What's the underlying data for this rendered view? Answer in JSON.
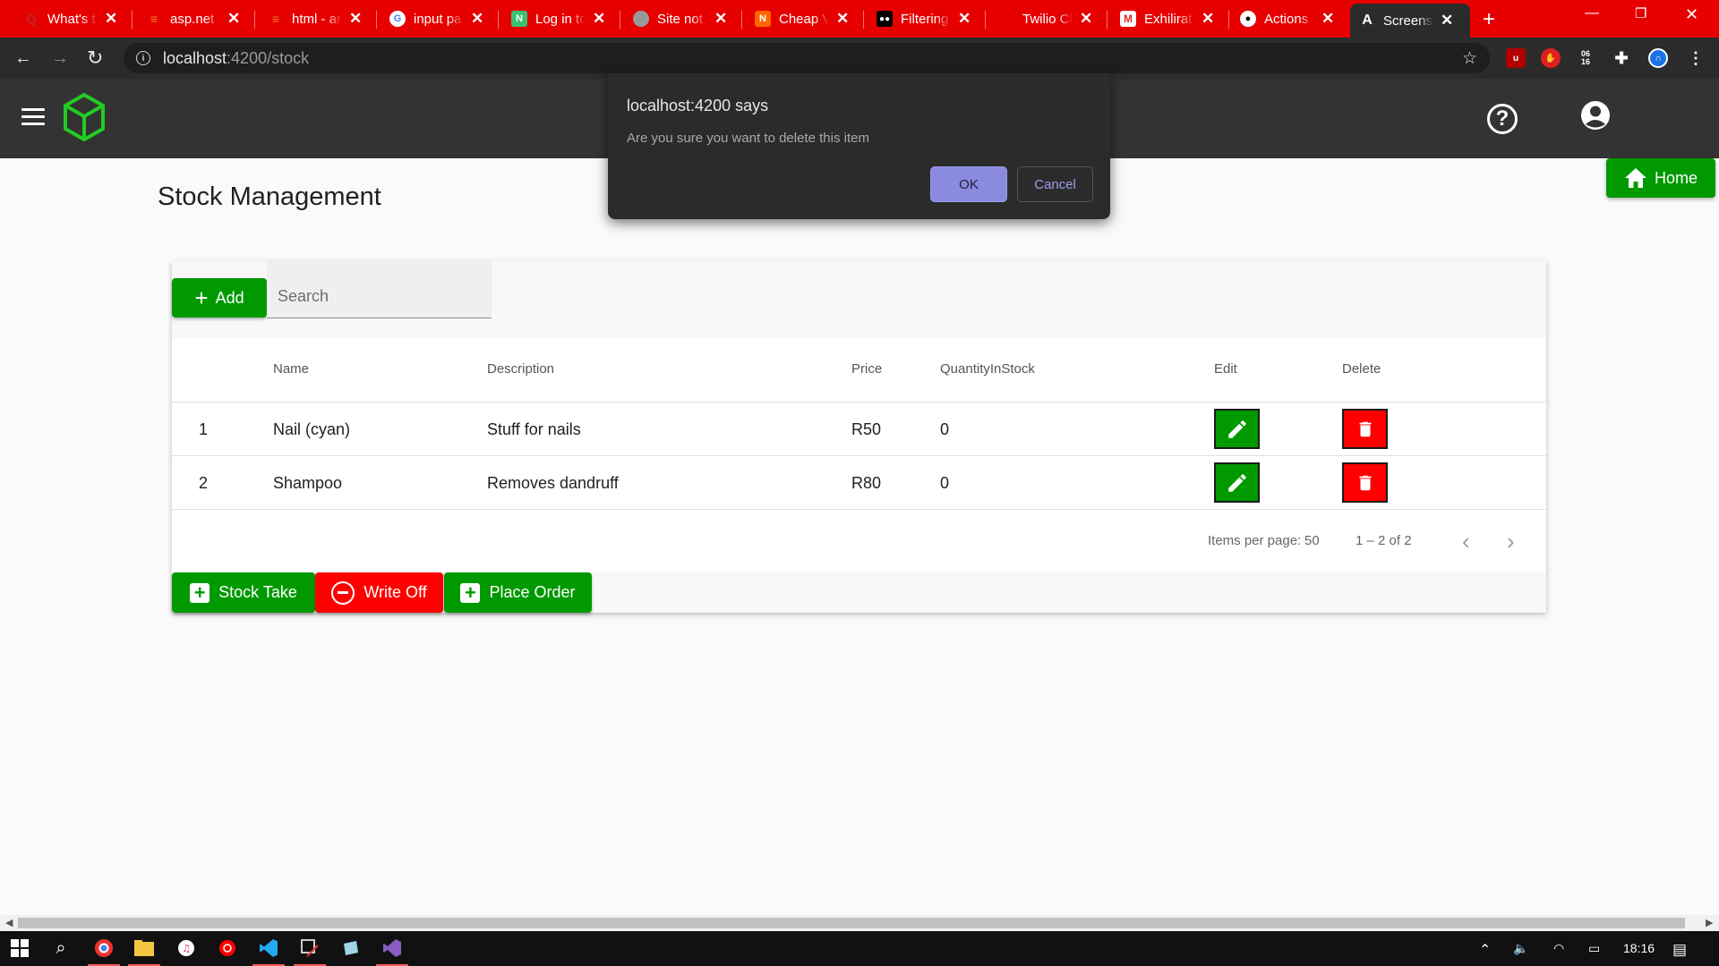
{
  "browser": {
    "tabs": [
      {
        "title": "What's t",
        "icon": "quora-icon",
        "color": "#b92b27"
      },
      {
        "title": "asp.net -",
        "icon": "stackoverflow-icon",
        "color": "#f48024"
      },
      {
        "title": "html - ar",
        "icon": "stackoverflow-icon",
        "color": "#f48024"
      },
      {
        "title": "input pa",
        "icon": "google-icon",
        "color": "#ffffff"
      },
      {
        "title": "Log in tc",
        "icon": "n-icon",
        "color": "#38c172"
      },
      {
        "title": "Site not",
        "icon": "globe-icon",
        "color": "#888888"
      },
      {
        "title": "Cheap V",
        "icon": "cheap-icon",
        "color": "#ff6600"
      },
      {
        "title": "Filtering",
        "icon": "medium-icon",
        "color": "#000000"
      },
      {
        "title": "Twilio Cl",
        "icon": "twilio-icon",
        "color": "#e60000"
      },
      {
        "title": "Exhilirat",
        "icon": "gmail-icon",
        "color": "#ffffff"
      },
      {
        "title": "Actions",
        "icon": "github-icon",
        "color": "#ffffff"
      }
    ],
    "active_tab": {
      "title": "Screens",
      "icon": "angular-icon"
    },
    "url_host": "localhost",
    "url_path": ":4200/stock",
    "clock_ext": "06\n16"
  },
  "app": {
    "home_label": "Home",
    "page_title": "Stock Management",
    "add_label": "Add",
    "search_placeholder": "Search",
    "columns": [
      "Name",
      "Description",
      "Price",
      "QuantityInStock",
      "Edit",
      "Delete"
    ],
    "rows": [
      {
        "index": "1",
        "name": "Nail (cyan)",
        "description": "Stuff for nails",
        "price": "R50",
        "qty": "0"
      },
      {
        "index": "2",
        "name": "Shampoo",
        "description": "Removes dandruff",
        "price": "R80",
        "qty": "0"
      }
    ],
    "paginator": {
      "label": "Items per page:",
      "size": "50",
      "range": "1 – 2 of 2"
    },
    "actions": {
      "stock_take": "Stock Take",
      "write_off": "Write Off",
      "place_order": "Place Order"
    },
    "colors": {
      "green": "#009900",
      "red": "#ff0000",
      "header": "#333333"
    }
  },
  "dialog": {
    "title": "localhost:4200 says",
    "message": "Are you sure you want to delete this item",
    "ok": "OK",
    "cancel": "Cancel"
  },
  "taskbar": {
    "time": "18:16"
  }
}
